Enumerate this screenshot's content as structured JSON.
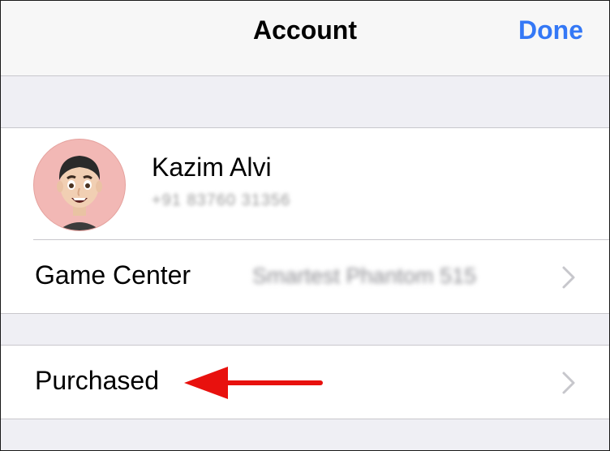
{
  "navbar": {
    "title": "Account",
    "done_label": "Done"
  },
  "profile": {
    "name": "Kazim Alvi",
    "phone": "+91 83760 31356",
    "avatar_icon": "memoji-avatar-icon"
  },
  "rows": [
    {
      "label": "Game Center",
      "value": "Smartest Phantom 515",
      "icon": "chevron-right-icon"
    },
    {
      "label": "Purchased",
      "icon": "chevron-right-icon"
    }
  ],
  "annotation": {
    "icon": "red-arrow-pointer",
    "color": "#e8110e"
  },
  "colors": {
    "accent": "#3478f6",
    "background": "#efeff4",
    "separator": "#c8c7cc"
  }
}
